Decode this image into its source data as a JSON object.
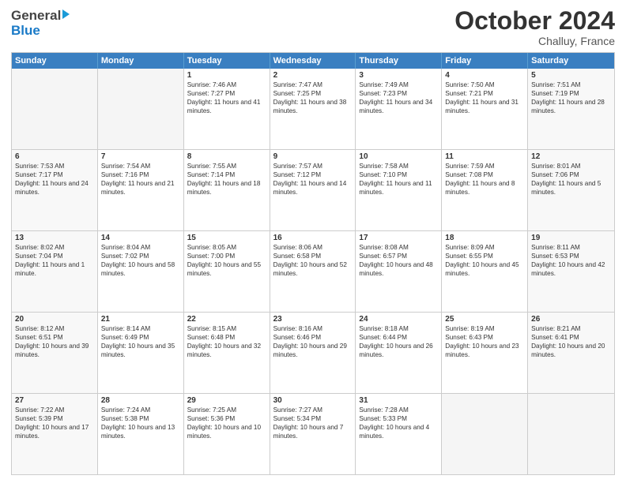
{
  "header": {
    "logo_line1": "General",
    "logo_line2": "Blue",
    "month_title": "October 2024",
    "location": "Challuy, France"
  },
  "days_of_week": [
    "Sunday",
    "Monday",
    "Tuesday",
    "Wednesday",
    "Thursday",
    "Friday",
    "Saturday"
  ],
  "weeks": [
    [
      {
        "day": "",
        "info": ""
      },
      {
        "day": "",
        "info": ""
      },
      {
        "day": "1",
        "info": "Sunrise: 7:46 AM\nSunset: 7:27 PM\nDaylight: 11 hours and 41 minutes."
      },
      {
        "day": "2",
        "info": "Sunrise: 7:47 AM\nSunset: 7:25 PM\nDaylight: 11 hours and 38 minutes."
      },
      {
        "day": "3",
        "info": "Sunrise: 7:49 AM\nSunset: 7:23 PM\nDaylight: 11 hours and 34 minutes."
      },
      {
        "day": "4",
        "info": "Sunrise: 7:50 AM\nSunset: 7:21 PM\nDaylight: 11 hours and 31 minutes."
      },
      {
        "day": "5",
        "info": "Sunrise: 7:51 AM\nSunset: 7:19 PM\nDaylight: 11 hours and 28 minutes."
      }
    ],
    [
      {
        "day": "6",
        "info": "Sunrise: 7:53 AM\nSunset: 7:17 PM\nDaylight: 11 hours and 24 minutes."
      },
      {
        "day": "7",
        "info": "Sunrise: 7:54 AM\nSunset: 7:16 PM\nDaylight: 11 hours and 21 minutes."
      },
      {
        "day": "8",
        "info": "Sunrise: 7:55 AM\nSunset: 7:14 PM\nDaylight: 11 hours and 18 minutes."
      },
      {
        "day": "9",
        "info": "Sunrise: 7:57 AM\nSunset: 7:12 PM\nDaylight: 11 hours and 14 minutes."
      },
      {
        "day": "10",
        "info": "Sunrise: 7:58 AM\nSunset: 7:10 PM\nDaylight: 11 hours and 11 minutes."
      },
      {
        "day": "11",
        "info": "Sunrise: 7:59 AM\nSunset: 7:08 PM\nDaylight: 11 hours and 8 minutes."
      },
      {
        "day": "12",
        "info": "Sunrise: 8:01 AM\nSunset: 7:06 PM\nDaylight: 11 hours and 5 minutes."
      }
    ],
    [
      {
        "day": "13",
        "info": "Sunrise: 8:02 AM\nSunset: 7:04 PM\nDaylight: 11 hours and 1 minute."
      },
      {
        "day": "14",
        "info": "Sunrise: 8:04 AM\nSunset: 7:02 PM\nDaylight: 10 hours and 58 minutes."
      },
      {
        "day": "15",
        "info": "Sunrise: 8:05 AM\nSunset: 7:00 PM\nDaylight: 10 hours and 55 minutes."
      },
      {
        "day": "16",
        "info": "Sunrise: 8:06 AM\nSunset: 6:58 PM\nDaylight: 10 hours and 52 minutes."
      },
      {
        "day": "17",
        "info": "Sunrise: 8:08 AM\nSunset: 6:57 PM\nDaylight: 10 hours and 48 minutes."
      },
      {
        "day": "18",
        "info": "Sunrise: 8:09 AM\nSunset: 6:55 PM\nDaylight: 10 hours and 45 minutes."
      },
      {
        "day": "19",
        "info": "Sunrise: 8:11 AM\nSunset: 6:53 PM\nDaylight: 10 hours and 42 minutes."
      }
    ],
    [
      {
        "day": "20",
        "info": "Sunrise: 8:12 AM\nSunset: 6:51 PM\nDaylight: 10 hours and 39 minutes."
      },
      {
        "day": "21",
        "info": "Sunrise: 8:14 AM\nSunset: 6:49 PM\nDaylight: 10 hours and 35 minutes."
      },
      {
        "day": "22",
        "info": "Sunrise: 8:15 AM\nSunset: 6:48 PM\nDaylight: 10 hours and 32 minutes."
      },
      {
        "day": "23",
        "info": "Sunrise: 8:16 AM\nSunset: 6:46 PM\nDaylight: 10 hours and 29 minutes."
      },
      {
        "day": "24",
        "info": "Sunrise: 8:18 AM\nSunset: 6:44 PM\nDaylight: 10 hours and 26 minutes."
      },
      {
        "day": "25",
        "info": "Sunrise: 8:19 AM\nSunset: 6:43 PM\nDaylight: 10 hours and 23 minutes."
      },
      {
        "day": "26",
        "info": "Sunrise: 8:21 AM\nSunset: 6:41 PM\nDaylight: 10 hours and 20 minutes."
      }
    ],
    [
      {
        "day": "27",
        "info": "Sunrise: 7:22 AM\nSunset: 5:39 PM\nDaylight: 10 hours and 17 minutes."
      },
      {
        "day": "28",
        "info": "Sunrise: 7:24 AM\nSunset: 5:38 PM\nDaylight: 10 hours and 13 minutes."
      },
      {
        "day": "29",
        "info": "Sunrise: 7:25 AM\nSunset: 5:36 PM\nDaylight: 10 hours and 10 minutes."
      },
      {
        "day": "30",
        "info": "Sunrise: 7:27 AM\nSunset: 5:34 PM\nDaylight: 10 hours and 7 minutes."
      },
      {
        "day": "31",
        "info": "Sunrise: 7:28 AM\nSunset: 5:33 PM\nDaylight: 10 hours and 4 minutes."
      },
      {
        "day": "",
        "info": ""
      },
      {
        "day": "",
        "info": ""
      }
    ]
  ]
}
